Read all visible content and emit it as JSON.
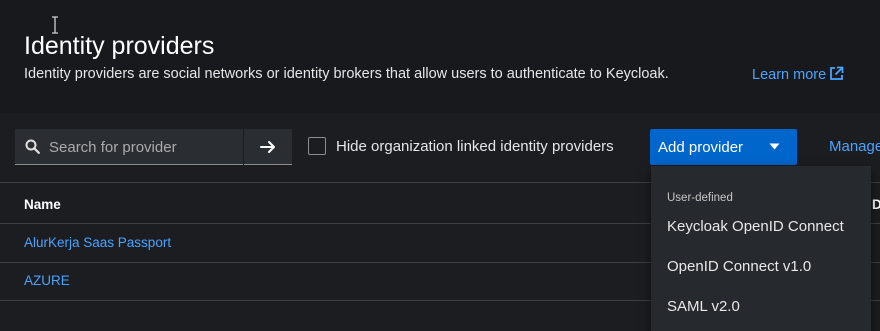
{
  "header": {
    "title": "Identity providers",
    "subtitle": "Identity providers are social networks or identity brokers that allow users to authenticate to Keycloak.",
    "learn_more": "Learn more"
  },
  "toolbar": {
    "search_placeholder": "Search for provider",
    "hide_org_label": "Hide organization linked identity providers",
    "hide_org_checked": false,
    "add_provider_label": "Add provider",
    "manage_label": "Manage"
  },
  "table": {
    "columns": [
      "Name",
      "De"
    ],
    "rows": [
      {
        "name": "AlurKerja Saas Passport"
      },
      {
        "name": "AZURE"
      }
    ]
  },
  "dropdown": {
    "group_title": "User-defined",
    "items": [
      "Keycloak OpenID Connect",
      "OpenID Connect v1.0",
      "SAML v2.0"
    ]
  },
  "colors": {
    "accent": "#0066cc",
    "link": "#4aa3ff",
    "background": "#1b1d21"
  },
  "icons": [
    "search-icon",
    "arrow-right-icon",
    "caret-down-icon",
    "external-link-icon",
    "text-cursor-icon"
  ]
}
